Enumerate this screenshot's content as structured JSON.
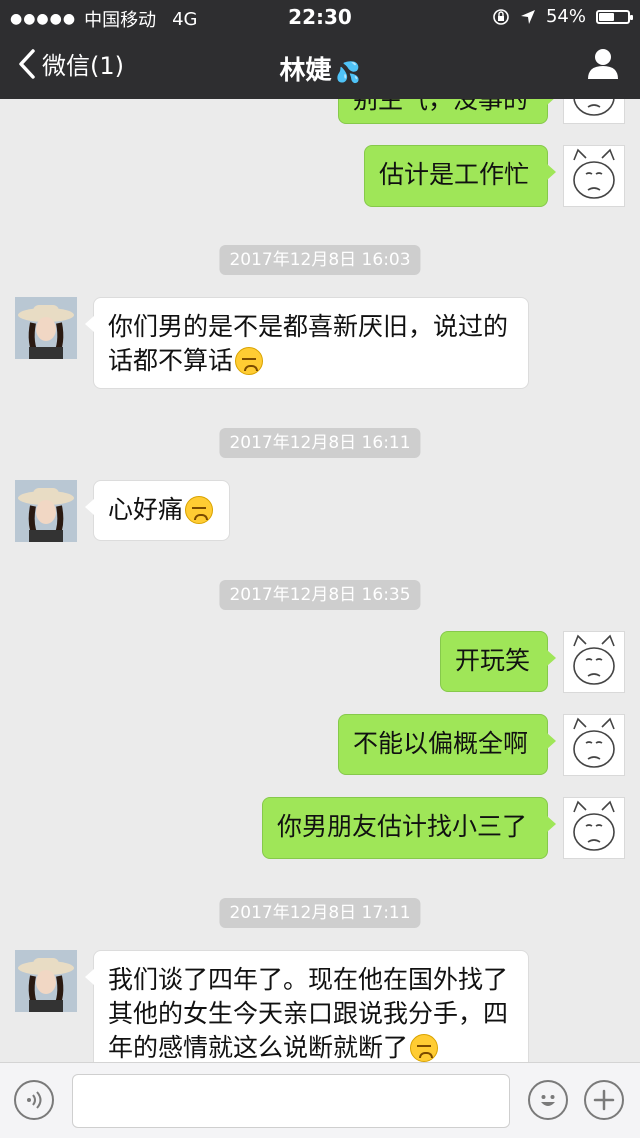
{
  "status_bar": {
    "signal": "●●●●●",
    "carrier": "中国移动",
    "network": "4G",
    "time": "22:30",
    "battery": "54%",
    "battery_level": 0.54
  },
  "nav": {
    "back_label": "微信(1)",
    "title": "林婕",
    "title_icon": "sweat-droplets-emoji"
  },
  "messages": [
    {
      "type": "sent",
      "text": "别生气，没事的"
    },
    {
      "type": "sent",
      "text": "估计是工作忙"
    },
    {
      "type": "timestamp",
      "text": "2017年12月8日 16:03"
    },
    {
      "type": "received",
      "line1": "你们男的是不是都喜新厌旧，说过的",
      "line2": "话都不算话",
      "emoji": "persevering-face"
    },
    {
      "type": "timestamp",
      "text": "2017年12月8日 16:11"
    },
    {
      "type": "received",
      "text": "心好痛",
      "emoji": "persevering-face"
    },
    {
      "type": "timestamp",
      "text": "2017年12月8日 16:35"
    },
    {
      "type": "sent",
      "text": "开玩笑"
    },
    {
      "type": "sent",
      "text": "不能以偏概全啊"
    },
    {
      "type": "sent",
      "text": "你男朋友估计找小三了"
    },
    {
      "type": "timestamp",
      "text": "2017年12月8日 17:11"
    },
    {
      "type": "received",
      "line1": "我们谈了四年了。现在他在国外找了",
      "line2": "其他的女生今天亲口跟说我分手，四",
      "line3": "年的感情就这么说断就断了",
      "emoji": "persevering-face"
    }
  ],
  "input_bar": {
    "voice_icon": "voice-icon",
    "placeholder": "",
    "emoji_icon": "smiley-icon",
    "more_icon": "plus-icon"
  },
  "colors": {
    "nav_bg": "#2e2e30",
    "chat_bg": "#ebebeb",
    "sent_bubble": "#9fe658",
    "received_bubble": "#ffffff"
  }
}
